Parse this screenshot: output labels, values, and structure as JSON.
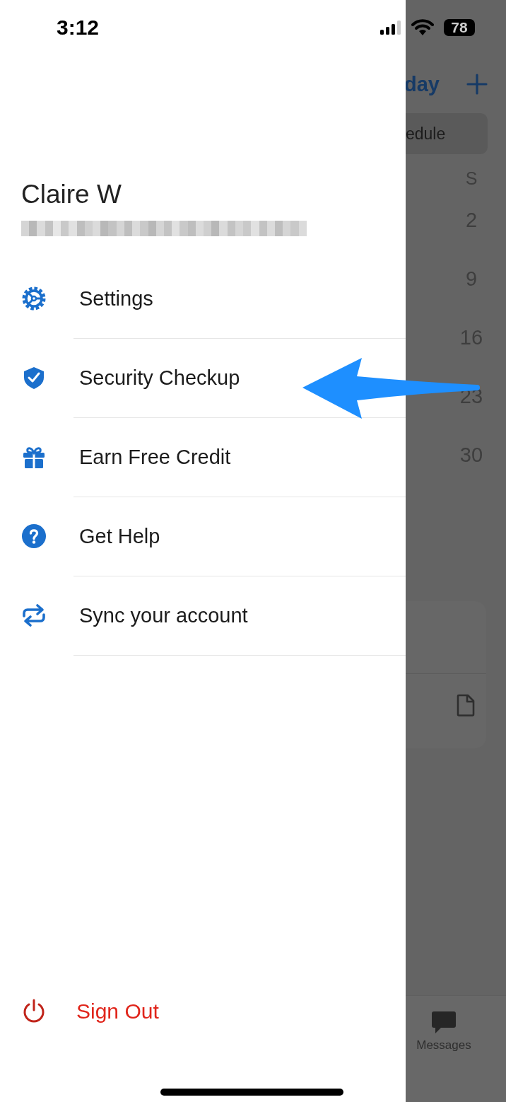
{
  "status_bar": {
    "time": "3:12",
    "battery": "78"
  },
  "profile": {
    "name": "Claire W",
    "email": {
      "kind": "redacted"
    }
  },
  "menu": [
    {
      "label": "Settings"
    },
    {
      "label": "Security Checkup"
    },
    {
      "label": "Earn Free Credit"
    },
    {
      "label": "Get Help"
    },
    {
      "label": "Sync your account"
    }
  ],
  "sign_out": {
    "label": "Sign Out"
  },
  "annotation": {
    "kind": "arrow"
  },
  "background_app": {
    "header_title": "day",
    "schedule_tab": "edule",
    "calendar": {
      "weekday": "S",
      "dates": [
        "2",
        "9",
        "16",
        "23",
        "30"
      ]
    },
    "tab_bar": [
      {
        "label": "Messages"
      }
    ]
  }
}
